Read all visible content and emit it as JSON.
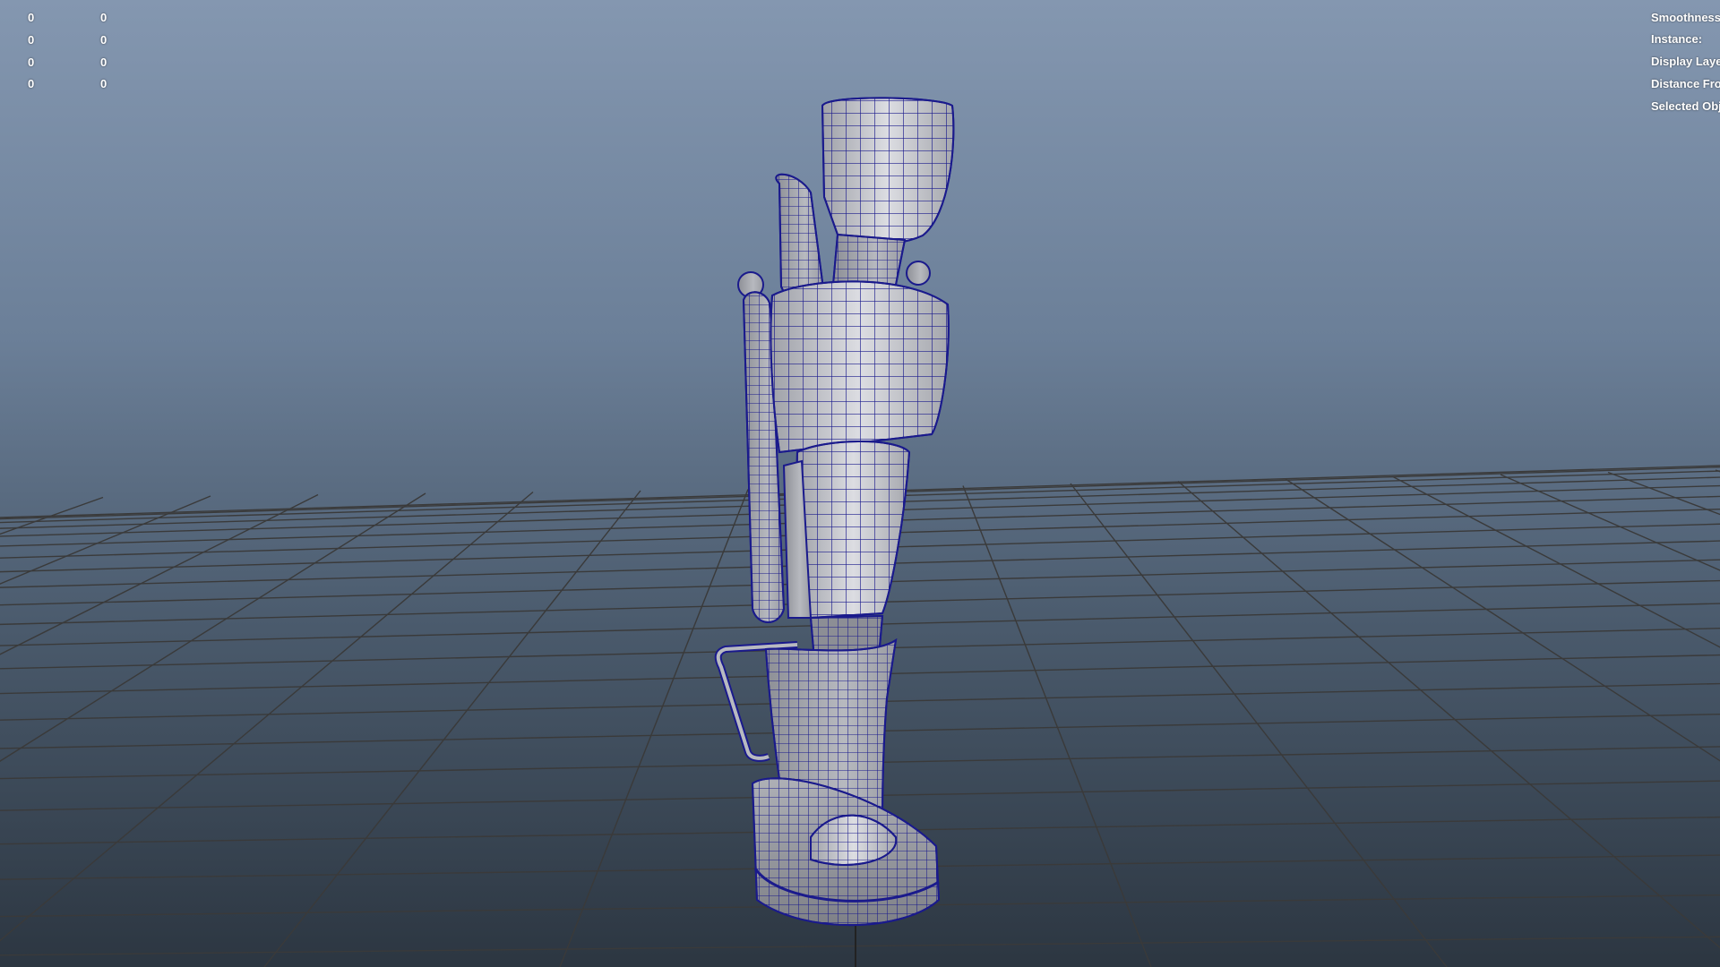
{
  "viewport": {
    "left_readouts": [
      {
        "col1": "0",
        "col2": "0"
      },
      {
        "col1": "0",
        "col2": "0"
      },
      {
        "col1": "0",
        "col2": "0"
      },
      {
        "col1": "0",
        "col2": "0"
      }
    ],
    "right_headsup": [
      "Smoothness",
      "Instance:",
      "Display Laye",
      "Distance Fro",
      "Selected Obj"
    ],
    "colors": {
      "wireframe": "#1a1a8c",
      "grid_line": "#3a3a3a",
      "grid_axis": "#222222",
      "mesh_fill": "#a8aab0",
      "hud_text": "#ffffff"
    },
    "model_icon": "prosthetic-leg-wireframe-model"
  }
}
